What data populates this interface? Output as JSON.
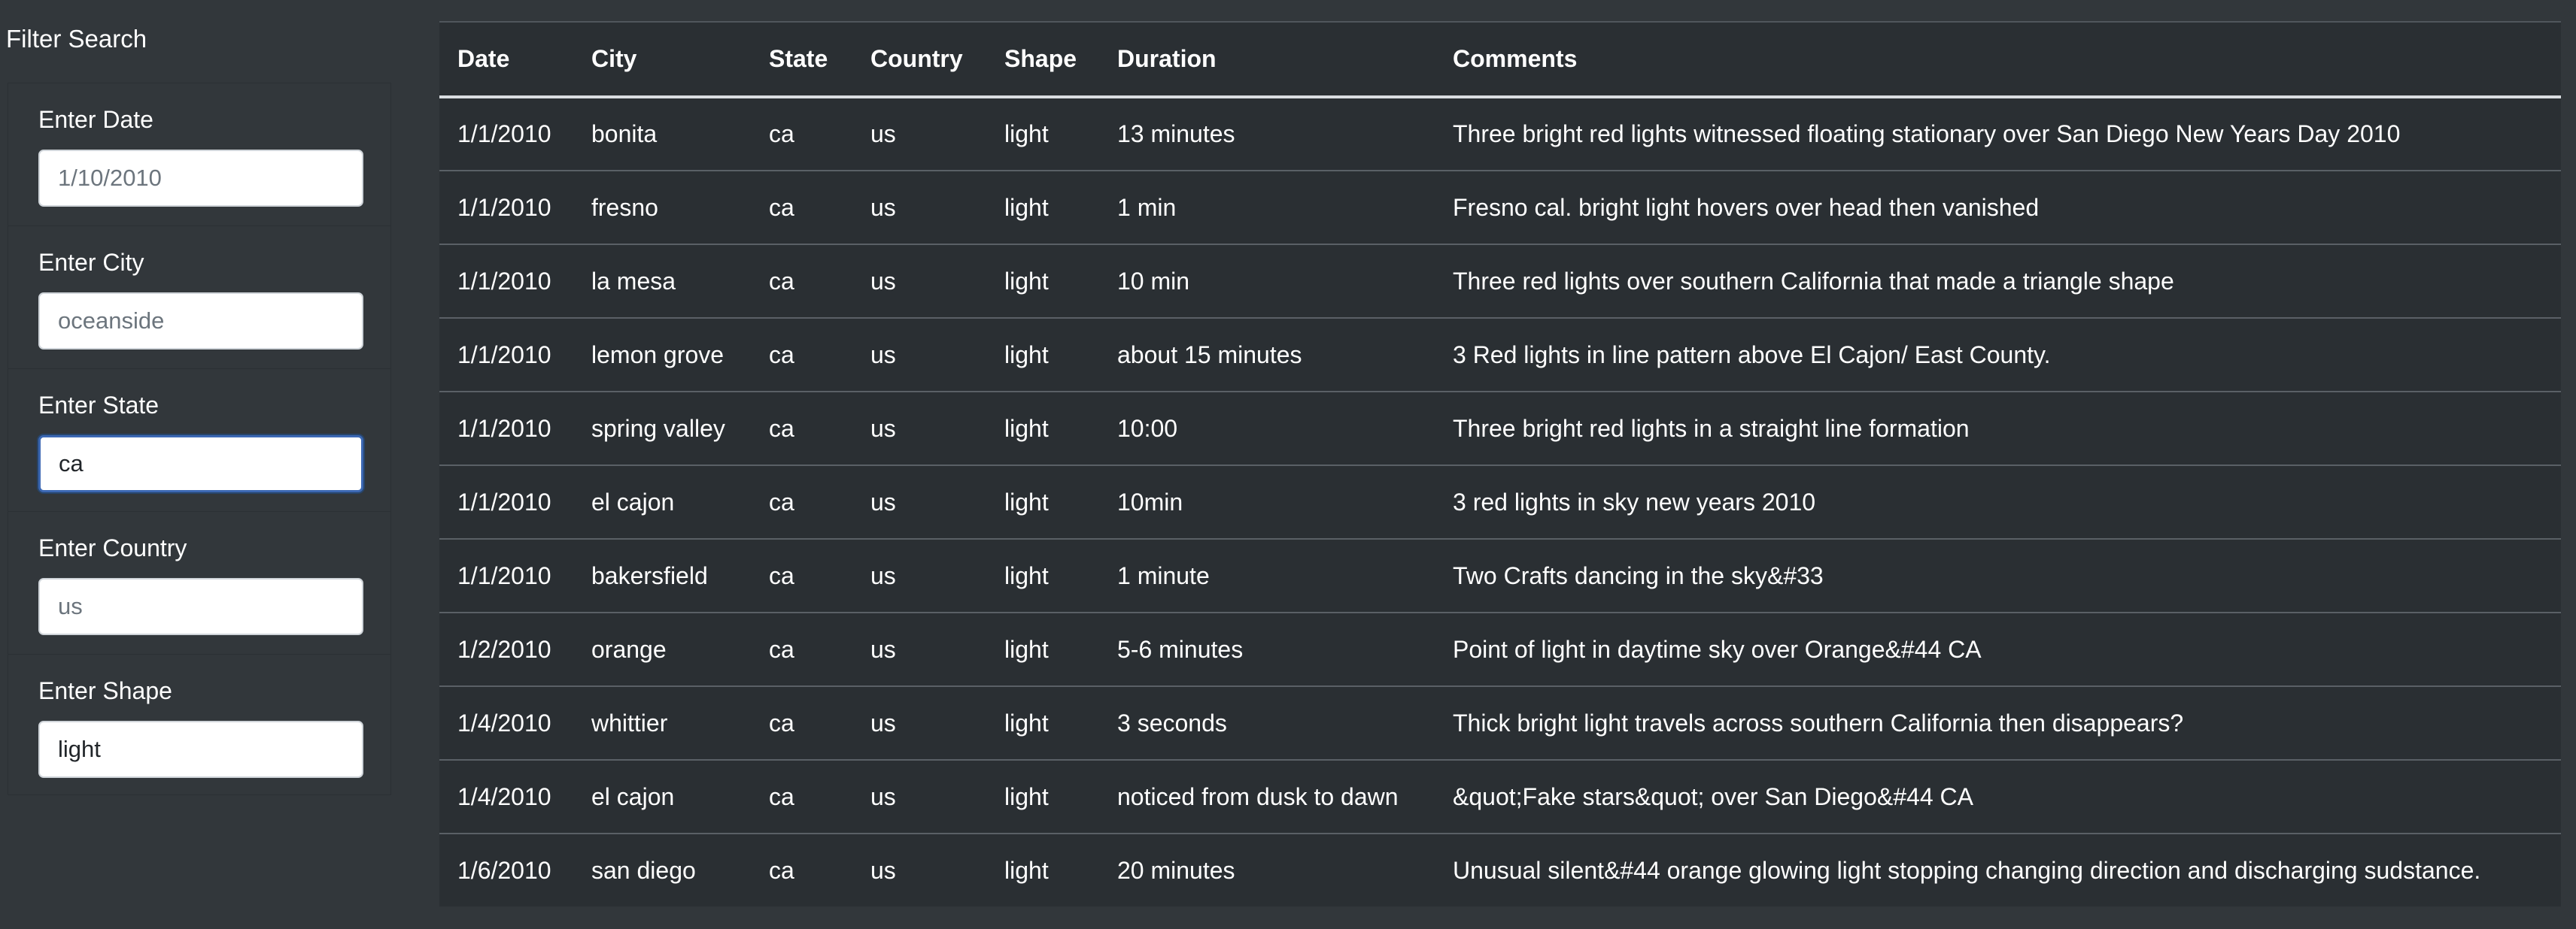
{
  "sidebar": {
    "title": "Filter Search",
    "filters": [
      {
        "label": "Enter Date",
        "placeholder": "1/10/2010",
        "value": ""
      },
      {
        "label": "Enter City",
        "placeholder": "oceanside",
        "value": ""
      },
      {
        "label": "Enter State",
        "placeholder": "",
        "value": "ca"
      },
      {
        "label": "Enter Country",
        "placeholder": "us",
        "value": ""
      },
      {
        "label": "Enter Shape",
        "placeholder": "",
        "value": "light"
      }
    ]
  },
  "table": {
    "headers": [
      "Date",
      "City",
      "State",
      "Country",
      "Shape",
      "Duration",
      "Comments"
    ],
    "rows": [
      [
        "1/1/2010",
        "bonita",
        "ca",
        "us",
        "light",
        "13 minutes",
        "Three bright red lights witnessed floating stationary over San Diego New Years Day 2010"
      ],
      [
        "1/1/2010",
        "fresno",
        "ca",
        "us",
        "light",
        "1 min",
        "Fresno cal. bright light hovers over head then vanished"
      ],
      [
        "1/1/2010",
        "la mesa",
        "ca",
        "us",
        "light",
        "10 min",
        "Three red lights over southern California that made a triangle shape"
      ],
      [
        "1/1/2010",
        "lemon grove",
        "ca",
        "us",
        "light",
        "about 15 minutes",
        "3 Red lights in line pattern above El Cajon/ East County."
      ],
      [
        "1/1/2010",
        "spring valley",
        "ca",
        "us",
        "light",
        "10:00",
        "Three bright red lights in a straight line formation"
      ],
      [
        "1/1/2010",
        "el cajon",
        "ca",
        "us",
        "light",
        "10min",
        "3 red lights in sky new years 2010"
      ],
      [
        "1/1/2010",
        "bakersfield",
        "ca",
        "us",
        "light",
        "1 minute",
        "Two Crafts dancing in the sky&#33"
      ],
      [
        "1/2/2010",
        "orange",
        "ca",
        "us",
        "light",
        "5-6 minutes",
        "Point of light in daytime sky over Orange&#44 CA"
      ],
      [
        "1/4/2010",
        "whittier",
        "ca",
        "us",
        "light",
        "3 seconds",
        "Thick bright light travels across southern California then disappears?"
      ],
      [
        "1/4/2010",
        "el cajon",
        "ca",
        "us",
        "light",
        "noticed from dusk to dawn",
        "&quot;Fake stars&quot; over San Diego&#44 CA"
      ],
      [
        "1/6/2010",
        "san diego",
        "ca",
        "us",
        "light",
        "20 minutes",
        "Unusual silent&#44 orange glowing light stopping changing direction and discharging sudstance."
      ]
    ]
  }
}
